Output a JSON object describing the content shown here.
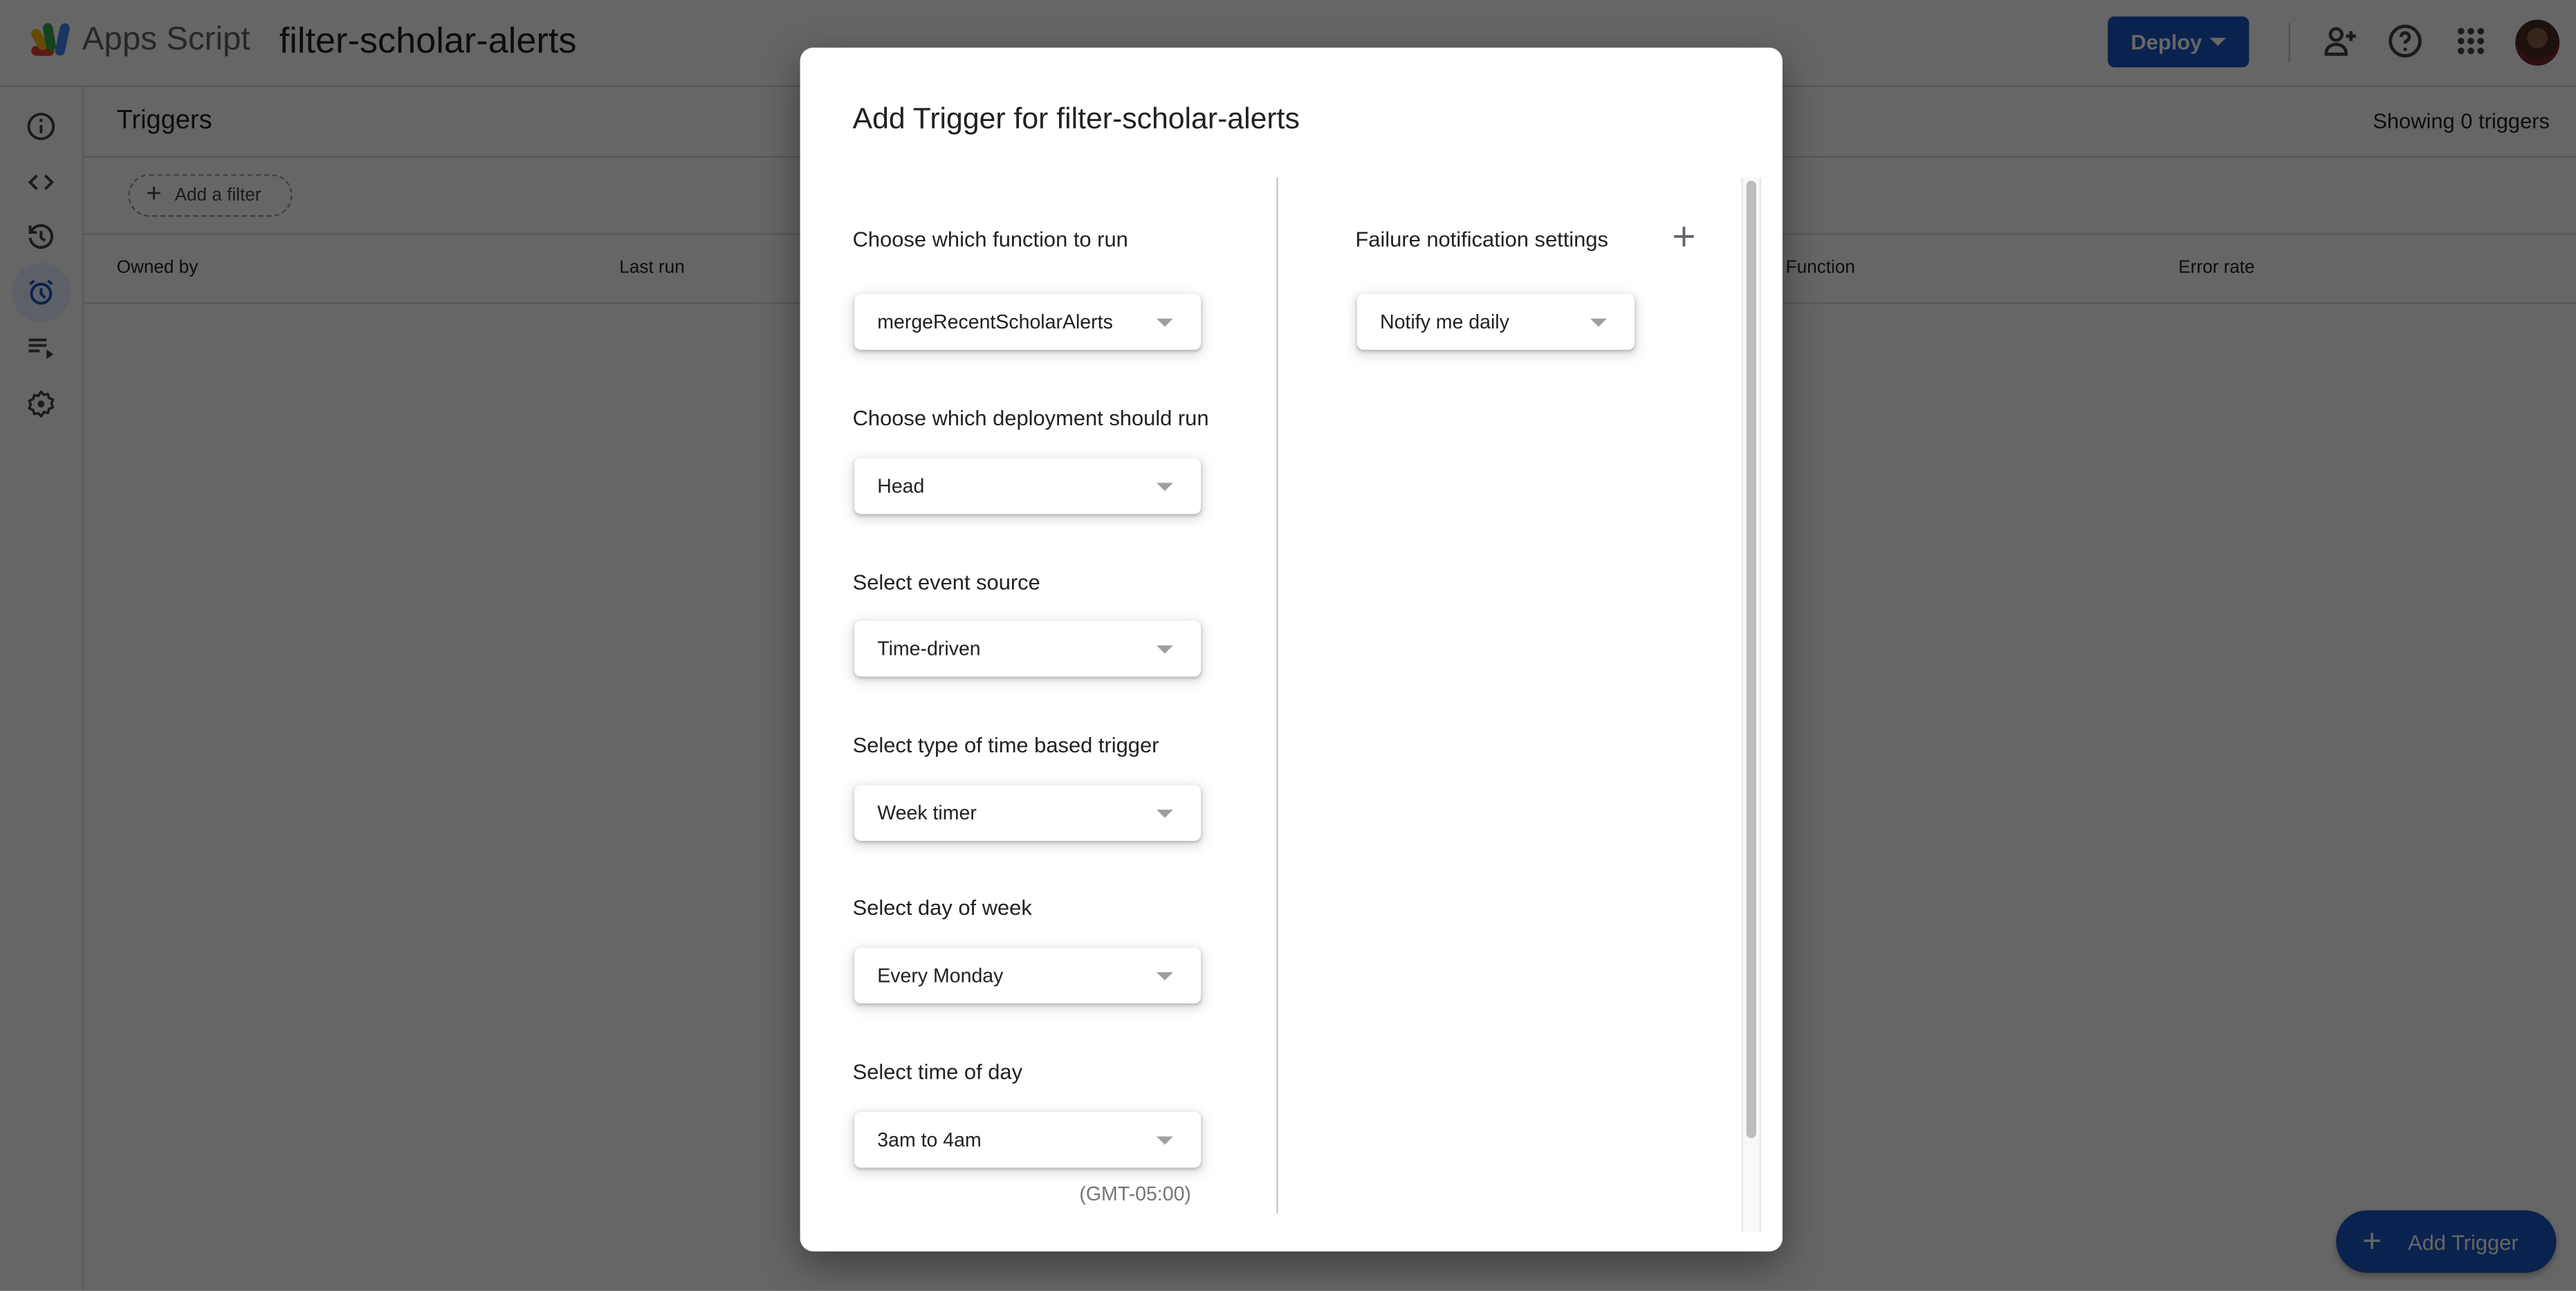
{
  "header": {
    "app_name": "Apps Script",
    "project_title": "filter-scholar-alerts",
    "deploy_label": "Deploy",
    "icons": [
      "add-person-icon",
      "help-icon",
      "apps-grid-icon",
      "account-avatar"
    ]
  },
  "rail": {
    "items": [
      {
        "name": "overview",
        "icon": "info-icon",
        "active": false
      },
      {
        "name": "editor",
        "icon": "code-icon",
        "active": false
      },
      {
        "name": "project-history",
        "icon": "history-icon",
        "active": false
      },
      {
        "name": "triggers",
        "icon": "alarm-icon",
        "active": true
      },
      {
        "name": "executions",
        "icon": "playlist-play-icon",
        "active": false
      },
      {
        "name": "project-settings",
        "icon": "gear-icon",
        "active": false
      }
    ]
  },
  "main": {
    "title": "Triggers",
    "count_text": "Showing 0 triggers",
    "filter_label": "Add a filter",
    "columns": [
      "Owned by",
      "Last run",
      "Function",
      "Error rate"
    ],
    "fab_label": "Add Trigger"
  },
  "dialog": {
    "title": "Add Trigger for filter-scholar-alerts",
    "fields": [
      {
        "label": "Choose which function to run",
        "value": "mergeRecentScholarAlerts"
      },
      {
        "label": "Choose which deployment should run",
        "value": "Head"
      },
      {
        "label": "Select event source",
        "value": "Time-driven"
      },
      {
        "label": "Select type of time based trigger",
        "value": "Week timer"
      },
      {
        "label": "Select day of week",
        "value": "Every Monday"
      },
      {
        "label": "Select time of day",
        "value": "3am to 4am"
      }
    ],
    "timezone": "(GMT-05:00)",
    "failure": {
      "label": "Failure notification settings",
      "value": "Notify me daily"
    }
  },
  "colors": {
    "accent": "#1a56c4",
    "scrim": "rgba(0,0,0,0.6)",
    "active_rail_bg": "#e8f0fe"
  }
}
